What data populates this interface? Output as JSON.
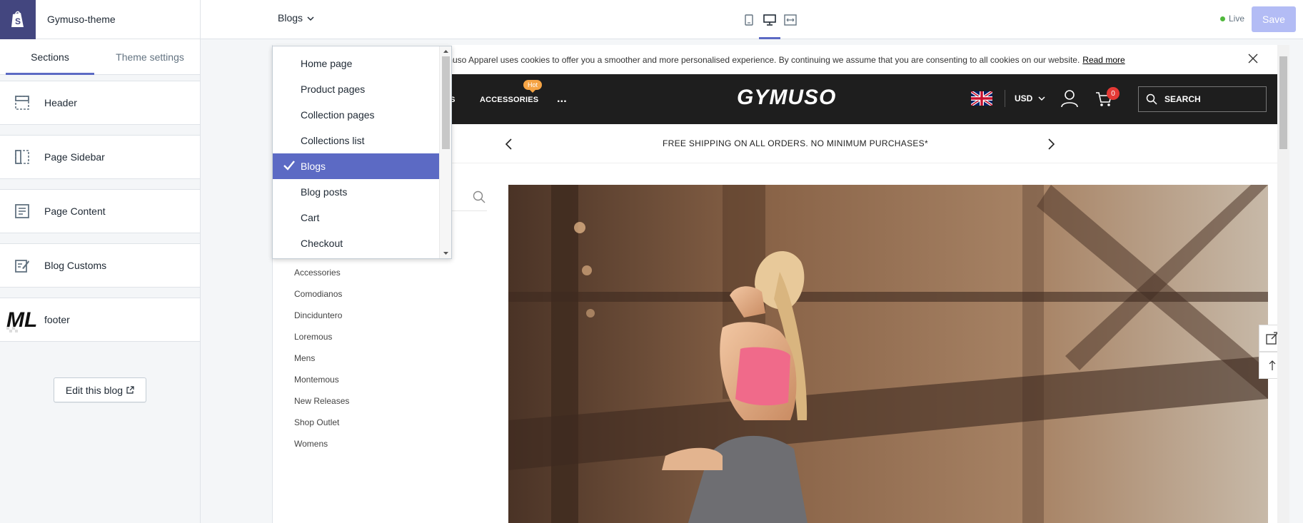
{
  "app": {
    "theme_name": "Gymuso-theme"
  },
  "sidebar": {
    "tabs": [
      {
        "label": "Sections"
      },
      {
        "label": "Theme settings"
      }
    ],
    "sections": [
      {
        "label": "Header",
        "icon": "header-layout-icon"
      },
      {
        "label": "Page Sidebar",
        "icon": "sidebar-layout-icon"
      },
      {
        "label": "Page Content",
        "icon": "content-layout-icon"
      },
      {
        "label": "Blog Customs",
        "icon": "edit-note-icon"
      },
      {
        "label": "footer",
        "icon": "ml-logo-thumbnail"
      }
    ],
    "edit_button": "Edit this blog"
  },
  "topbar": {
    "page_select": "Blogs",
    "status": "Live",
    "save": "Save",
    "devices": [
      "mobile-icon",
      "desktop-icon",
      "fullscreen-icon"
    ]
  },
  "dropdown": {
    "options": [
      {
        "label": "Home page"
      },
      {
        "label": "Product pages"
      },
      {
        "label": "Collection pages"
      },
      {
        "label": "Collections list"
      },
      {
        "label": "Blogs",
        "selected": true
      },
      {
        "label": "Blog posts"
      },
      {
        "label": "Cart"
      },
      {
        "label": "Checkout"
      }
    ]
  },
  "preview": {
    "cookie_text": "muso Apparel uses cookies to offer you a smoother and more personalised experience. By continuing we assume that you are consenting to all cookies on our website.",
    "cookie_link": "Read more",
    "nav": {
      "partial": "NS",
      "accessories": "ACCESSORIES",
      "more": "...",
      "hot_badge": "Hot"
    },
    "logo": "GYMUSO",
    "currency": "USD",
    "cart_count": "0",
    "search_placeholder": "SEARCH",
    "promo": "FREE SHIPPING ON ALL ORDERS. NO MINIMUM PURCHASES*",
    "categories": [
      "Accessories",
      "Comodianos",
      "Dinciduntero",
      "Loremous",
      "Mens",
      "Montemous",
      "New Releases",
      "Shop Outlet",
      "Womens"
    ]
  },
  "colors": {
    "accent": "#5c6ac4",
    "shopify_bar": "#43467f",
    "header_bg": "#1e1e1e",
    "hot_badge": "#f5a445",
    "cart_badge": "#e53935",
    "live": "#50b83c"
  }
}
